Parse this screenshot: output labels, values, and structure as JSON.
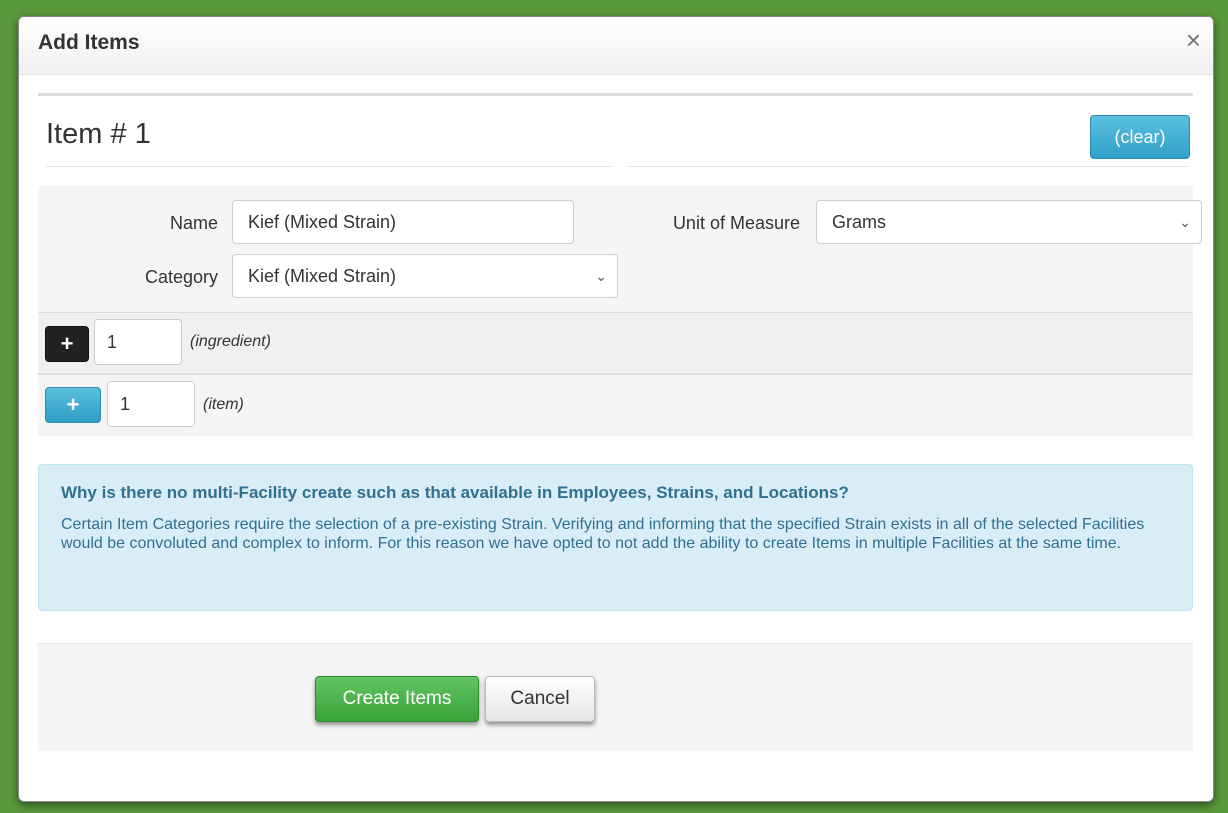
{
  "modal": {
    "title": "Add Items",
    "close_glyph": "×"
  },
  "item": {
    "heading": "Item # 1",
    "clear_label": "(clear)",
    "name_label": "Name",
    "name_value": "Kief (Mixed Strain)",
    "category_label": "Category",
    "category_value": "Kief (Mixed Strain)",
    "uom_label": "Unit of Measure",
    "uom_value": "Grams",
    "chevron_glyph": "⌄"
  },
  "ingredient_row": {
    "plus_glyph": "+",
    "quantity": "1",
    "hint": "(ingredient)"
  },
  "item_row": {
    "plus_glyph": "+",
    "quantity": "1",
    "hint": "(item)"
  },
  "info": {
    "title": "Why is there no multi-Facility create such as that available in Employees, Strains, and Locations?",
    "body": "Certain Item Categories require the selection of a pre-existing Strain. Verifying and informing that the specified Strain exists in all of the selected Facilities would be convoluted and complex to inform. For this reason we have opted to not add the ability to create Items in multiple Facilities at the same time."
  },
  "footer": {
    "create_label": "Create Items",
    "cancel_label": "Cancel"
  },
  "colors": {
    "primary": "#5bc0de",
    "success": "#5cb85c",
    "info_bg": "#d9edf7",
    "info_text": "#31708f"
  }
}
